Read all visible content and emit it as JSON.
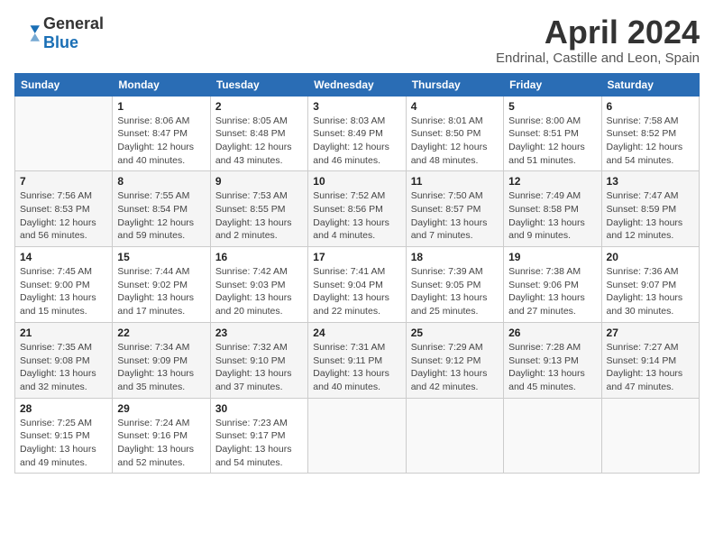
{
  "header": {
    "logo_general": "General",
    "logo_blue": "Blue",
    "month_year": "April 2024",
    "location": "Endrinal, Castille and Leon, Spain"
  },
  "weekdays": [
    "Sunday",
    "Monday",
    "Tuesday",
    "Wednesday",
    "Thursday",
    "Friday",
    "Saturday"
  ],
  "weeks": [
    [
      {
        "day": "",
        "sunrise": "",
        "sunset": "",
        "daylight": ""
      },
      {
        "day": "1",
        "sunrise": "Sunrise: 8:06 AM",
        "sunset": "Sunset: 8:47 PM",
        "daylight": "Daylight: 12 hours and 40 minutes."
      },
      {
        "day": "2",
        "sunrise": "Sunrise: 8:05 AM",
        "sunset": "Sunset: 8:48 PM",
        "daylight": "Daylight: 12 hours and 43 minutes."
      },
      {
        "day": "3",
        "sunrise": "Sunrise: 8:03 AM",
        "sunset": "Sunset: 8:49 PM",
        "daylight": "Daylight: 12 hours and 46 minutes."
      },
      {
        "day": "4",
        "sunrise": "Sunrise: 8:01 AM",
        "sunset": "Sunset: 8:50 PM",
        "daylight": "Daylight: 12 hours and 48 minutes."
      },
      {
        "day": "5",
        "sunrise": "Sunrise: 8:00 AM",
        "sunset": "Sunset: 8:51 PM",
        "daylight": "Daylight: 12 hours and 51 minutes."
      },
      {
        "day": "6",
        "sunrise": "Sunrise: 7:58 AM",
        "sunset": "Sunset: 8:52 PM",
        "daylight": "Daylight: 12 hours and 54 minutes."
      }
    ],
    [
      {
        "day": "7",
        "sunrise": "Sunrise: 7:56 AM",
        "sunset": "Sunset: 8:53 PM",
        "daylight": "Daylight: 12 hours and 56 minutes."
      },
      {
        "day": "8",
        "sunrise": "Sunrise: 7:55 AM",
        "sunset": "Sunset: 8:54 PM",
        "daylight": "Daylight: 12 hours and 59 minutes."
      },
      {
        "day": "9",
        "sunrise": "Sunrise: 7:53 AM",
        "sunset": "Sunset: 8:55 PM",
        "daylight": "Daylight: 13 hours and 2 minutes."
      },
      {
        "day": "10",
        "sunrise": "Sunrise: 7:52 AM",
        "sunset": "Sunset: 8:56 PM",
        "daylight": "Daylight: 13 hours and 4 minutes."
      },
      {
        "day": "11",
        "sunrise": "Sunrise: 7:50 AM",
        "sunset": "Sunset: 8:57 PM",
        "daylight": "Daylight: 13 hours and 7 minutes."
      },
      {
        "day": "12",
        "sunrise": "Sunrise: 7:49 AM",
        "sunset": "Sunset: 8:58 PM",
        "daylight": "Daylight: 13 hours and 9 minutes."
      },
      {
        "day": "13",
        "sunrise": "Sunrise: 7:47 AM",
        "sunset": "Sunset: 8:59 PM",
        "daylight": "Daylight: 13 hours and 12 minutes."
      }
    ],
    [
      {
        "day": "14",
        "sunrise": "Sunrise: 7:45 AM",
        "sunset": "Sunset: 9:00 PM",
        "daylight": "Daylight: 13 hours and 15 minutes."
      },
      {
        "day": "15",
        "sunrise": "Sunrise: 7:44 AM",
        "sunset": "Sunset: 9:02 PM",
        "daylight": "Daylight: 13 hours and 17 minutes."
      },
      {
        "day": "16",
        "sunrise": "Sunrise: 7:42 AM",
        "sunset": "Sunset: 9:03 PM",
        "daylight": "Daylight: 13 hours and 20 minutes."
      },
      {
        "day": "17",
        "sunrise": "Sunrise: 7:41 AM",
        "sunset": "Sunset: 9:04 PM",
        "daylight": "Daylight: 13 hours and 22 minutes."
      },
      {
        "day": "18",
        "sunrise": "Sunrise: 7:39 AM",
        "sunset": "Sunset: 9:05 PM",
        "daylight": "Daylight: 13 hours and 25 minutes."
      },
      {
        "day": "19",
        "sunrise": "Sunrise: 7:38 AM",
        "sunset": "Sunset: 9:06 PM",
        "daylight": "Daylight: 13 hours and 27 minutes."
      },
      {
        "day": "20",
        "sunrise": "Sunrise: 7:36 AM",
        "sunset": "Sunset: 9:07 PM",
        "daylight": "Daylight: 13 hours and 30 minutes."
      }
    ],
    [
      {
        "day": "21",
        "sunrise": "Sunrise: 7:35 AM",
        "sunset": "Sunset: 9:08 PM",
        "daylight": "Daylight: 13 hours and 32 minutes."
      },
      {
        "day": "22",
        "sunrise": "Sunrise: 7:34 AM",
        "sunset": "Sunset: 9:09 PM",
        "daylight": "Daylight: 13 hours and 35 minutes."
      },
      {
        "day": "23",
        "sunrise": "Sunrise: 7:32 AM",
        "sunset": "Sunset: 9:10 PM",
        "daylight": "Daylight: 13 hours and 37 minutes."
      },
      {
        "day": "24",
        "sunrise": "Sunrise: 7:31 AM",
        "sunset": "Sunset: 9:11 PM",
        "daylight": "Daylight: 13 hours and 40 minutes."
      },
      {
        "day": "25",
        "sunrise": "Sunrise: 7:29 AM",
        "sunset": "Sunset: 9:12 PM",
        "daylight": "Daylight: 13 hours and 42 minutes."
      },
      {
        "day": "26",
        "sunrise": "Sunrise: 7:28 AM",
        "sunset": "Sunset: 9:13 PM",
        "daylight": "Daylight: 13 hours and 45 minutes."
      },
      {
        "day": "27",
        "sunrise": "Sunrise: 7:27 AM",
        "sunset": "Sunset: 9:14 PM",
        "daylight": "Daylight: 13 hours and 47 minutes."
      }
    ],
    [
      {
        "day": "28",
        "sunrise": "Sunrise: 7:25 AM",
        "sunset": "Sunset: 9:15 PM",
        "daylight": "Daylight: 13 hours and 49 minutes."
      },
      {
        "day": "29",
        "sunrise": "Sunrise: 7:24 AM",
        "sunset": "Sunset: 9:16 PM",
        "daylight": "Daylight: 13 hours and 52 minutes."
      },
      {
        "day": "30",
        "sunrise": "Sunrise: 7:23 AM",
        "sunset": "Sunset: 9:17 PM",
        "daylight": "Daylight: 13 hours and 54 minutes."
      },
      {
        "day": "",
        "sunrise": "",
        "sunset": "",
        "daylight": ""
      },
      {
        "day": "",
        "sunrise": "",
        "sunset": "",
        "daylight": ""
      },
      {
        "day": "",
        "sunrise": "",
        "sunset": "",
        "daylight": ""
      },
      {
        "day": "",
        "sunrise": "",
        "sunset": "",
        "daylight": ""
      }
    ]
  ]
}
